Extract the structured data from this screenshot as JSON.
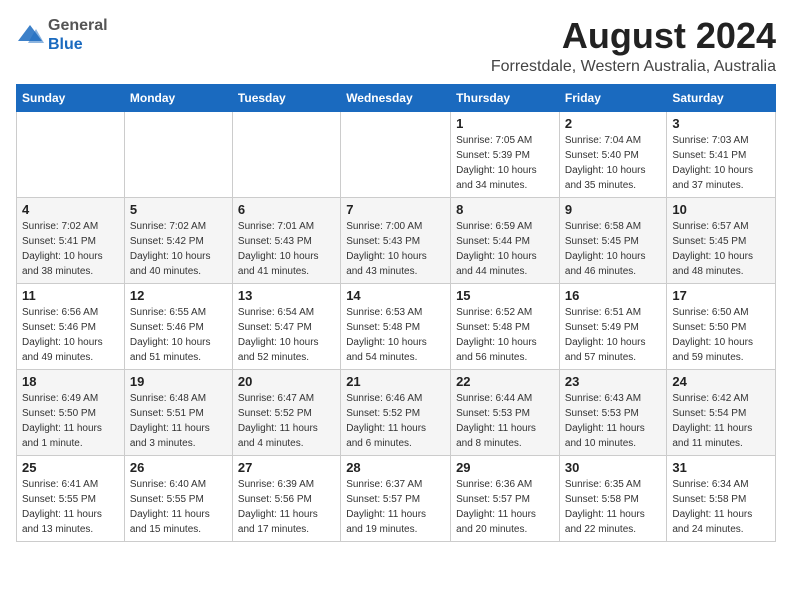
{
  "logo": {
    "general": "General",
    "blue": "Blue"
  },
  "header": {
    "title": "August 2024",
    "subtitle": "Forrestdale, Western Australia, Australia"
  },
  "weekdays": [
    "Sunday",
    "Monday",
    "Tuesday",
    "Wednesday",
    "Thursday",
    "Friday",
    "Saturday"
  ],
  "weeks": [
    [
      {
        "day": "",
        "detail": ""
      },
      {
        "day": "",
        "detail": ""
      },
      {
        "day": "",
        "detail": ""
      },
      {
        "day": "",
        "detail": ""
      },
      {
        "day": "1",
        "detail": "Sunrise: 7:05 AM\nSunset: 5:39 PM\nDaylight: 10 hours\nand 34 minutes."
      },
      {
        "day": "2",
        "detail": "Sunrise: 7:04 AM\nSunset: 5:40 PM\nDaylight: 10 hours\nand 35 minutes."
      },
      {
        "day": "3",
        "detail": "Sunrise: 7:03 AM\nSunset: 5:41 PM\nDaylight: 10 hours\nand 37 minutes."
      }
    ],
    [
      {
        "day": "4",
        "detail": "Sunrise: 7:02 AM\nSunset: 5:41 PM\nDaylight: 10 hours\nand 38 minutes."
      },
      {
        "day": "5",
        "detail": "Sunrise: 7:02 AM\nSunset: 5:42 PM\nDaylight: 10 hours\nand 40 minutes."
      },
      {
        "day": "6",
        "detail": "Sunrise: 7:01 AM\nSunset: 5:43 PM\nDaylight: 10 hours\nand 41 minutes."
      },
      {
        "day": "7",
        "detail": "Sunrise: 7:00 AM\nSunset: 5:43 PM\nDaylight: 10 hours\nand 43 minutes."
      },
      {
        "day": "8",
        "detail": "Sunrise: 6:59 AM\nSunset: 5:44 PM\nDaylight: 10 hours\nand 44 minutes."
      },
      {
        "day": "9",
        "detail": "Sunrise: 6:58 AM\nSunset: 5:45 PM\nDaylight: 10 hours\nand 46 minutes."
      },
      {
        "day": "10",
        "detail": "Sunrise: 6:57 AM\nSunset: 5:45 PM\nDaylight: 10 hours\nand 48 minutes."
      }
    ],
    [
      {
        "day": "11",
        "detail": "Sunrise: 6:56 AM\nSunset: 5:46 PM\nDaylight: 10 hours\nand 49 minutes."
      },
      {
        "day": "12",
        "detail": "Sunrise: 6:55 AM\nSunset: 5:46 PM\nDaylight: 10 hours\nand 51 minutes."
      },
      {
        "day": "13",
        "detail": "Sunrise: 6:54 AM\nSunset: 5:47 PM\nDaylight: 10 hours\nand 52 minutes."
      },
      {
        "day": "14",
        "detail": "Sunrise: 6:53 AM\nSunset: 5:48 PM\nDaylight: 10 hours\nand 54 minutes."
      },
      {
        "day": "15",
        "detail": "Sunrise: 6:52 AM\nSunset: 5:48 PM\nDaylight: 10 hours\nand 56 minutes."
      },
      {
        "day": "16",
        "detail": "Sunrise: 6:51 AM\nSunset: 5:49 PM\nDaylight: 10 hours\nand 57 minutes."
      },
      {
        "day": "17",
        "detail": "Sunrise: 6:50 AM\nSunset: 5:50 PM\nDaylight: 10 hours\nand 59 minutes."
      }
    ],
    [
      {
        "day": "18",
        "detail": "Sunrise: 6:49 AM\nSunset: 5:50 PM\nDaylight: 11 hours\nand 1 minute."
      },
      {
        "day": "19",
        "detail": "Sunrise: 6:48 AM\nSunset: 5:51 PM\nDaylight: 11 hours\nand 3 minutes."
      },
      {
        "day": "20",
        "detail": "Sunrise: 6:47 AM\nSunset: 5:52 PM\nDaylight: 11 hours\nand 4 minutes."
      },
      {
        "day": "21",
        "detail": "Sunrise: 6:46 AM\nSunset: 5:52 PM\nDaylight: 11 hours\nand 6 minutes."
      },
      {
        "day": "22",
        "detail": "Sunrise: 6:44 AM\nSunset: 5:53 PM\nDaylight: 11 hours\nand 8 minutes."
      },
      {
        "day": "23",
        "detail": "Sunrise: 6:43 AM\nSunset: 5:53 PM\nDaylight: 11 hours\nand 10 minutes."
      },
      {
        "day": "24",
        "detail": "Sunrise: 6:42 AM\nSunset: 5:54 PM\nDaylight: 11 hours\nand 11 minutes."
      }
    ],
    [
      {
        "day": "25",
        "detail": "Sunrise: 6:41 AM\nSunset: 5:55 PM\nDaylight: 11 hours\nand 13 minutes."
      },
      {
        "day": "26",
        "detail": "Sunrise: 6:40 AM\nSunset: 5:55 PM\nDaylight: 11 hours\nand 15 minutes."
      },
      {
        "day": "27",
        "detail": "Sunrise: 6:39 AM\nSunset: 5:56 PM\nDaylight: 11 hours\nand 17 minutes."
      },
      {
        "day": "28",
        "detail": "Sunrise: 6:37 AM\nSunset: 5:57 PM\nDaylight: 11 hours\nand 19 minutes."
      },
      {
        "day": "29",
        "detail": "Sunrise: 6:36 AM\nSunset: 5:57 PM\nDaylight: 11 hours\nand 20 minutes."
      },
      {
        "day": "30",
        "detail": "Sunrise: 6:35 AM\nSunset: 5:58 PM\nDaylight: 11 hours\nand 22 minutes."
      },
      {
        "day": "31",
        "detail": "Sunrise: 6:34 AM\nSunset: 5:58 PM\nDaylight: 11 hours\nand 24 minutes."
      }
    ]
  ]
}
